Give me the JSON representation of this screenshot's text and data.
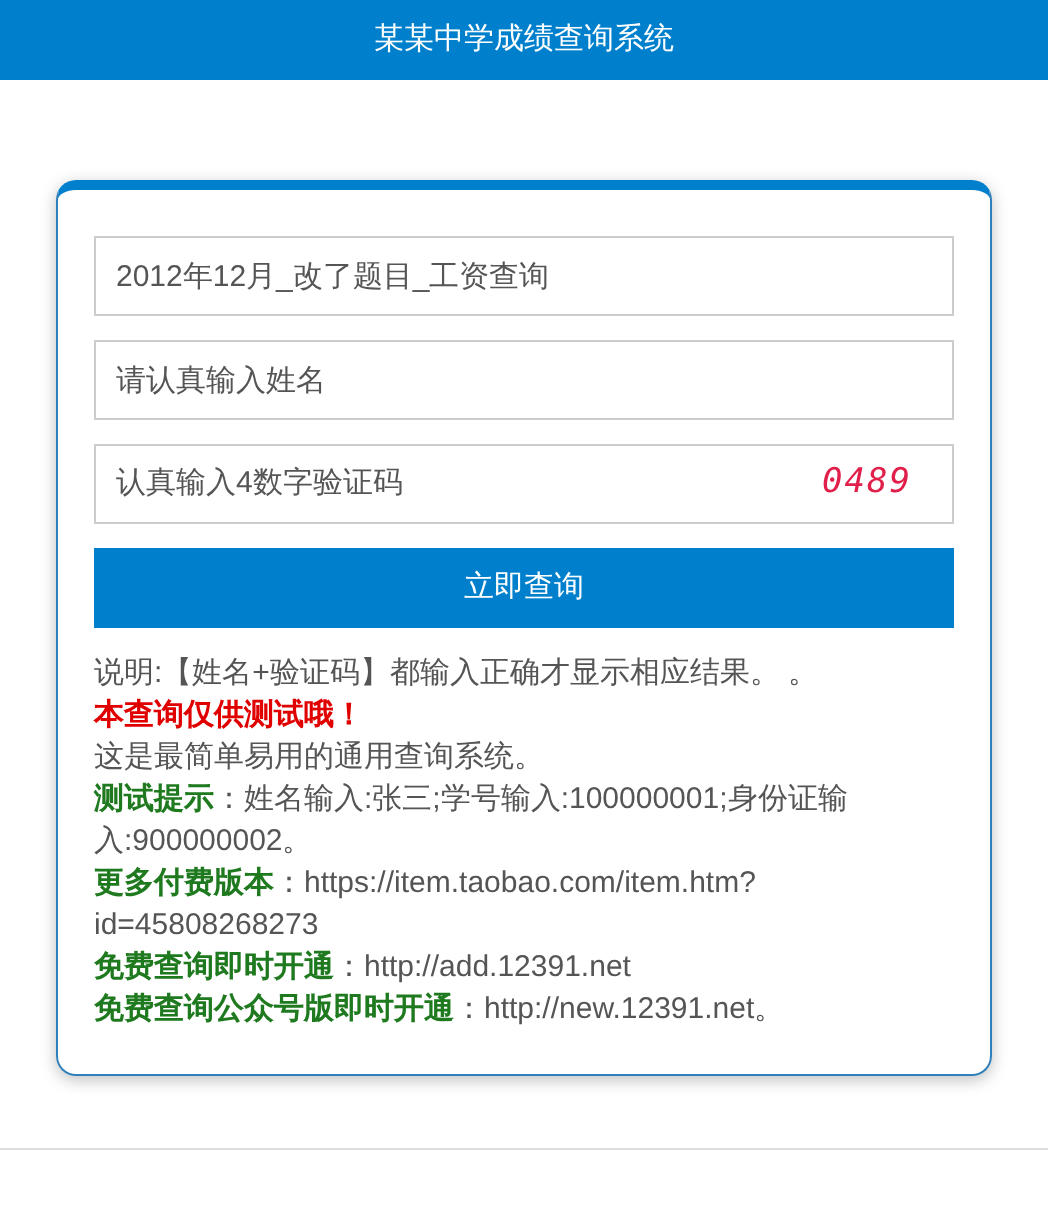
{
  "header": {
    "title": "某某中学成绩查询系统"
  },
  "form": {
    "fields": [
      {
        "kind": "select",
        "value": "2012年12月_改了题目_工资查询"
      },
      {
        "kind": "text",
        "placeholder": "请认真输入姓名"
      },
      {
        "kind": "captcha",
        "placeholder": "认真输入4数字验证码",
        "captcha": "0489"
      }
    ],
    "submit": "立即查询"
  },
  "notes": [
    {
      "kind": "plain",
      "text": "说明:【姓名+验证码】都输入正确才显示相应结果。 。"
    },
    {
      "kind": "alert",
      "text": "本查询仅供测试哦！"
    },
    {
      "kind": "plain",
      "text": "这是最简单易用的通用查询系统。"
    },
    {
      "kind": "labeled",
      "label": "测试提示",
      "text": "：姓名输入:张三;学号输入:100000001;身份证输入:900000002。"
    },
    {
      "kind": "labeled",
      "label": "更多付费版本",
      "text": "：https://item.taobao.com/item.htm?id=45808268273"
    },
    {
      "kind": "labeled",
      "label": "免费查询即时开通",
      "text": "：http://add.12391.net"
    },
    {
      "kind": "labeled",
      "label": "免费查询公众号版即时开通",
      "text": "：http://new.12391.net。"
    }
  ]
}
